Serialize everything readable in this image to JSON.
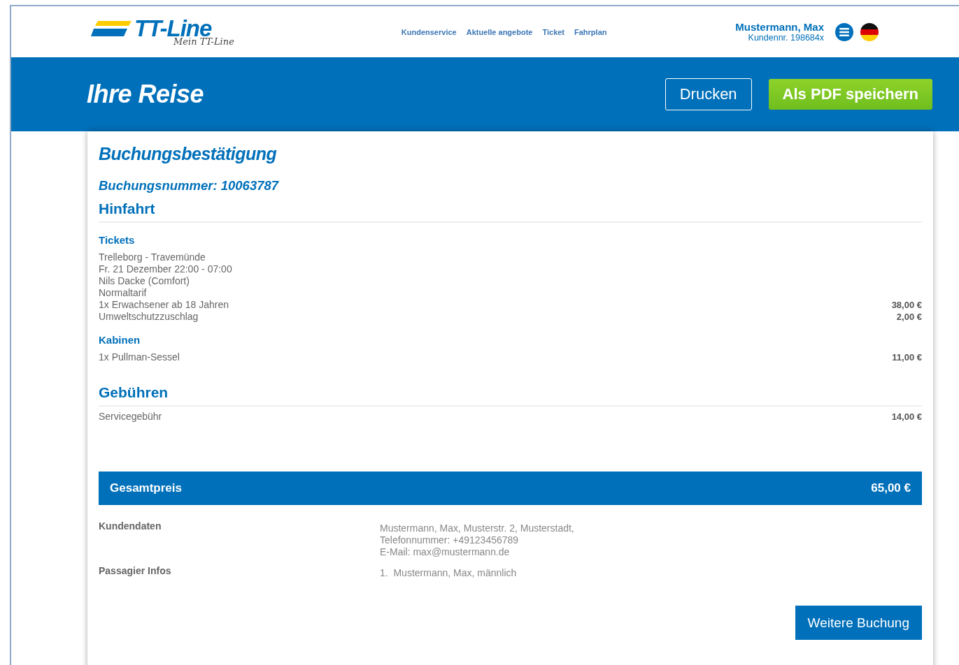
{
  "header": {
    "logo": {
      "brand": "TT-Line",
      "tagline": "Mein TT-Line"
    },
    "nav": [
      "Kundenservice",
      "Aktuelle angebote",
      "Ticket",
      "Fahrplan"
    ],
    "user": {
      "name": "Mustermann, Max",
      "customer_number": "Kundennr. 198684x"
    }
  },
  "banner": {
    "title": "Ihre Reise",
    "buttons": [
      {
        "label": "Drucken",
        "kind": "outline"
      },
      {
        "label": "Als PDF speichern",
        "kind": "primary"
      }
    ]
  },
  "confirmation": {
    "title": "Buchungsbestätigung",
    "booking_number": "Buchungsnummer: 10063787",
    "sections": [
      {
        "title": "Hinfahrt",
        "groups": [
          {
            "title": "Tickets",
            "lines": [
              {
                "text": "Trelleborg - Travemünde"
              },
              {
                "text": "Fr. 21 Dezember 22:00 - 07:00"
              },
              {
                "text": "Nils Dacke (Comfort)"
              },
              {
                "text": "Normaltarif"
              },
              {
                "text": "1x Erwachsener ab 18 Jahren",
                "price": "38,00 €"
              },
              {
                "text": "Umweltschutzzuschlag",
                "price": "2,00 €"
              }
            ]
          },
          {
            "title": "Kabinen",
            "lines": [
              {
                "text": "1x Pullman-Sessel",
                "price": "11,00 €"
              }
            ]
          }
        ]
      },
      {
        "title": "Gebühren",
        "groups": [
          {
            "lines": [
              {
                "text": "Servicegebühr",
                "price": "14,00 €"
              }
            ]
          }
        ]
      }
    ],
    "total": {
      "label": "Gesamtpreis",
      "amount": "65,00 €"
    },
    "details": [
      {
        "label": "Kundendaten",
        "lines": [
          "Mustermann, Max, Musterstr. 2, Musterstadt,",
          "Telefonnummer: +49123456789",
          "E-Mail: max@mustermann.de"
        ]
      },
      {
        "label": "Passagier Infos",
        "lines": [
          "1.  Mustermann, Max, männlich"
        ]
      }
    ],
    "action": "Weitere Buchung"
  }
}
